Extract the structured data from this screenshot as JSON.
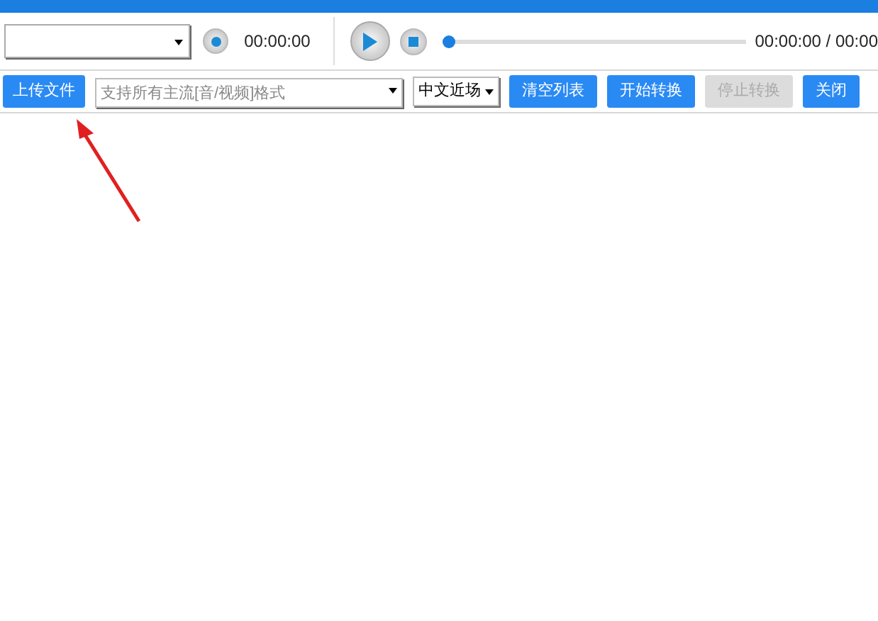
{
  "player": {
    "record_time": "00:00:00",
    "progress": {
      "level": 0
    },
    "time_display": "00:00:00 / 00:00"
  },
  "toolbar": {
    "upload_button": "上传文件",
    "format_field": {
      "placeholder": "支持所有主流[音/视频]格式"
    },
    "language_select": "中文近场",
    "buttons": [
      {
        "label": "清空列表",
        "disabled": false
      },
      {
        "label": "开始转换",
        "disabled": false
      },
      {
        "label": "停止转换",
        "disabled": true
      },
      {
        "label": "关闭",
        "disabled": false
      }
    ]
  }
}
